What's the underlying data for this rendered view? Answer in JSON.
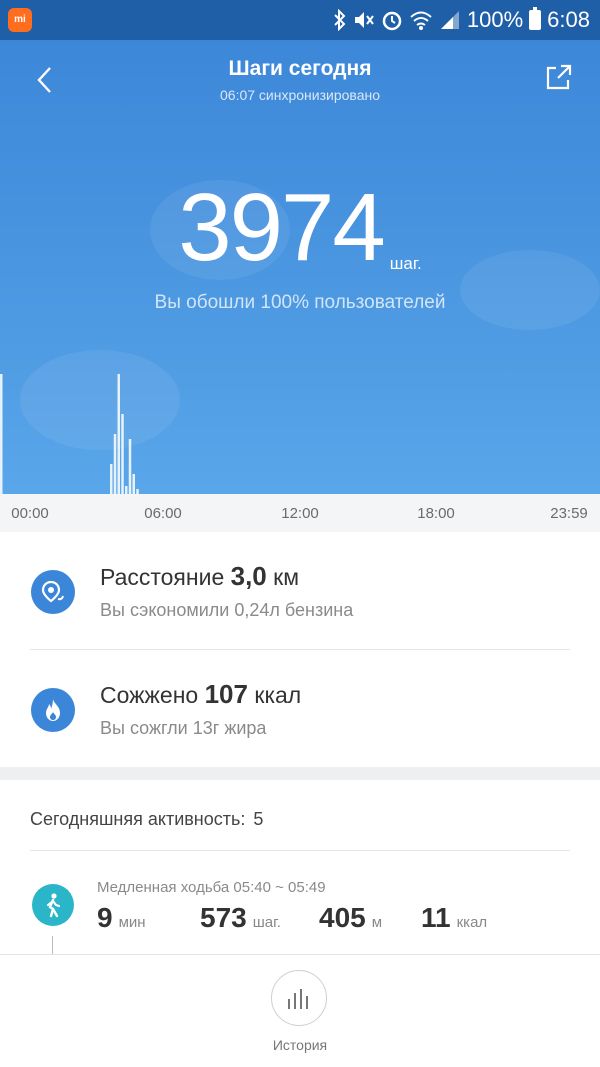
{
  "status_bar": {
    "app_icon_text": "mi",
    "battery": "100%",
    "time": "6:08",
    "icons": [
      "bluetooth-icon",
      "mute-icon",
      "alarm-icon",
      "wifi-icon",
      "signal-icon",
      "battery-icon"
    ]
  },
  "header": {
    "title": "Шаги сегодня",
    "subtitle": "06:07 синхронизировано"
  },
  "steps": {
    "value": "3974",
    "unit": "шаг.",
    "percentile_text": "Вы обошли 100% пользователей"
  },
  "chart_data": {
    "type": "bar",
    "x": [
      0.0,
      4.4,
      4.55,
      4.7,
      4.85,
      5.0,
      5.15,
      5.3,
      5.45,
      5.6
    ],
    "values": [
      120,
      30,
      60,
      120,
      80,
      8,
      55,
      20,
      5,
      0
    ],
    "xlim": [
      0,
      24
    ],
    "tick_labels": [
      "00:00",
      "06:00",
      "12:00",
      "18:00",
      "23:59"
    ],
    "grid": false
  },
  "stats": {
    "distance": {
      "label": "Расстояние",
      "value": "3,0",
      "unit": "км",
      "sub": "Вы сэкономили 0,24л бензина"
    },
    "calories": {
      "label": "Сожжено",
      "value": "107",
      "unit": "ккал",
      "sub": "Вы сожгли 13г жира"
    }
  },
  "activity": {
    "header": "Сегодняшняя активность:",
    "count": "5",
    "items": [
      {
        "title": "Медленная ходьба 05:40 ~ 05:49",
        "duration": "9",
        "duration_unit": "мин",
        "steps": "573",
        "steps_unit": "шаг.",
        "distance": "405",
        "distance_unit": "м",
        "calories": "11",
        "calories_unit": "ккал"
      }
    ]
  },
  "bottom_nav": {
    "history_label": "История"
  },
  "colors": {
    "hero_top": "#3d87d9",
    "hero_bottom": "#5aa6ea",
    "accent_blue": "#3b86d8",
    "activity_teal": "#2bb5c8",
    "status_bar": "#1f5fa8"
  }
}
